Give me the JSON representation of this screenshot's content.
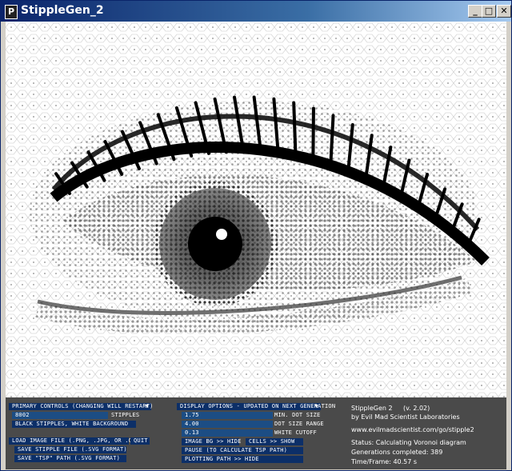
{
  "window": {
    "title": "StippleGen_2",
    "icon_letter": "P",
    "minimize_glyph": "_",
    "maximize_glyph": "□",
    "close_glyph": "✕"
  },
  "canvas": {
    "image": "eye-stipple-voronoi",
    "description_icon": "stipple-canvas-icon"
  },
  "primary": {
    "header": "PRIMARY CONTROLS (CHANGING WILL RESTART)",
    "stipples_value": "8002",
    "stipples_label": "STIPPLES",
    "mode_button": "BLACK STIPPLES, WHITE BACKGROUND",
    "load_button": "LOAD IMAGE FILE (.PNG, .JPG, OR .GIF)",
    "quit_button": "QUIT",
    "save_stipple_button": "SAVE STIPPLE FILE (.SVG FORMAT)",
    "save_tsp_button": "SAVE \"TSP\" PATH (.SVG FORMAT)"
  },
  "display": {
    "header": "DISPLAY OPTIONS - UPDATED ON NEXT GENERATION",
    "min_dot_value": "1.75",
    "min_dot_label": "MIN. DOT SIZE",
    "dot_range_value": "4.00",
    "dot_range_label": "DOT SIZE RANGE",
    "white_cutoff_value": "0.13",
    "white_cutoff_label": "WHITE CUTOFF",
    "image_bg_button": "IMAGE BG >> HIDE",
    "cells_button": "CELLS >> SHOW",
    "pause_button": "PAUSE (TO CALCULATE TSP PATH)",
    "plotting_button": "PLOTTING PATH >> HIDE"
  },
  "info": {
    "app_name": "StippleGen 2",
    "version": "(v. 2.02)",
    "author": "by Evil Mad Scientist Laboratories",
    "url": "www.evilmadscientist.com/go/stipple2",
    "status": "Status: Calculating Voronoi diagram",
    "generations": "Generations completed: 389",
    "time_frame": "Time/Frame: 40.57 s"
  },
  "colors": {
    "panel_bg": "#4a4a4a",
    "control_bg": "#0c2f68",
    "field_bg": "#1c4d84",
    "titlebar": "#0a246a"
  }
}
